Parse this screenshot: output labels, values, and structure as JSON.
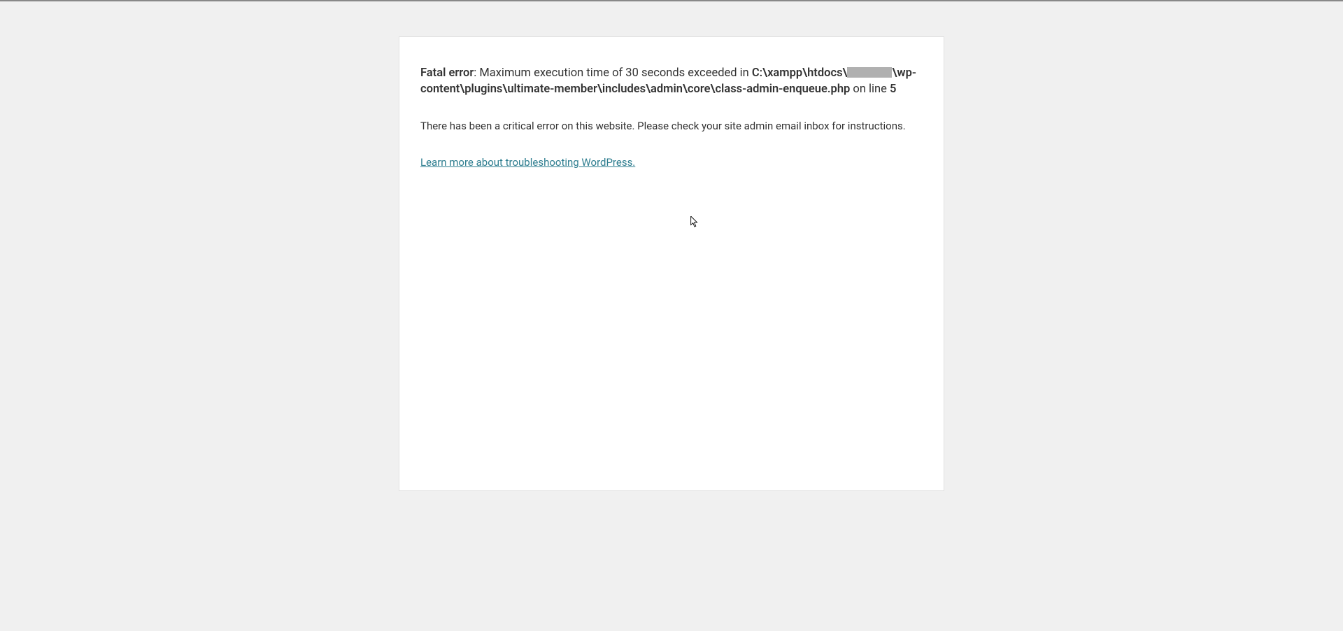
{
  "error": {
    "label": "Fatal error",
    "separator": ": ",
    "message_before_path": "Maximum execution time of 30 seconds exceeded in ",
    "path_part1": "C:\\xampp\\htdocs\\",
    "path_part2": "\\wp-content\\plugins\\ultimate-member\\includes\\admin\\core\\class-admin-enqueue.php",
    "on_line_text": " on line ",
    "line_number": "5"
  },
  "critical_error": "There has been a critical error on this website. Please check your site admin email inbox for instructions.",
  "link": {
    "text": "Learn more about troubleshooting WordPress."
  }
}
